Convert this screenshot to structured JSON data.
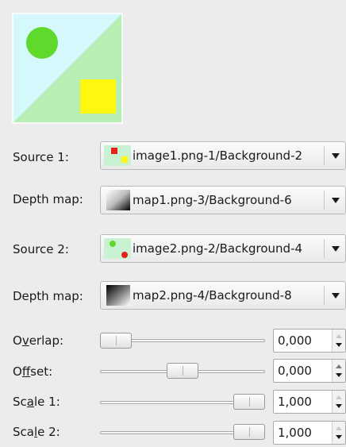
{
  "source1": {
    "label": "Source 1:",
    "value": "image1.png-1/Background-2"
  },
  "depth1": {
    "label": "Depth map:",
    "value": "map1.png-3/Background-6"
  },
  "source2": {
    "label": "Source 2:",
    "value": "image2.png-2/Background-4"
  },
  "depth2": {
    "label": "Depth map:",
    "value": "map2.png-4/Background-8"
  },
  "overlap": {
    "pre": "O",
    "mnemonic": "v",
    "post": "erlap:",
    "value": "0,000",
    "fraction": 0.0
  },
  "offset": {
    "pre": "O",
    "mnemonic": "f",
    "post": "fset:",
    "value": "0,000",
    "fraction": 0.5
  },
  "scale1": {
    "pre": "Sc",
    "mnemonic": "a",
    "post": "le 1:",
    "value": "1,000",
    "fraction": 1.0
  },
  "scale2": {
    "pre": "Sca",
    "mnemonic": "l",
    "post": "e 2:",
    "value": "1,000",
    "fraction": 1.0
  },
  "colors": {
    "cyan": "#d4f8fb",
    "lightgreen": "#b6eeb4",
    "green": "#5ed92c",
    "yellow": "#fff70f",
    "red": "#e81f1f"
  }
}
